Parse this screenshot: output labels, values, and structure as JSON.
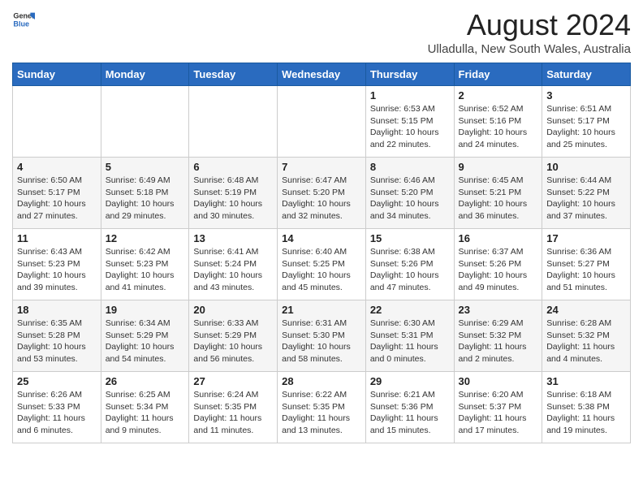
{
  "logo": {
    "line1": "General",
    "line2": "Blue"
  },
  "title": "August 2024",
  "location": "Ulladulla, New South Wales, Australia",
  "days_of_week": [
    "Sunday",
    "Monday",
    "Tuesday",
    "Wednesday",
    "Thursday",
    "Friday",
    "Saturday"
  ],
  "weeks": [
    [
      {
        "day": "",
        "info": ""
      },
      {
        "day": "",
        "info": ""
      },
      {
        "day": "",
        "info": ""
      },
      {
        "day": "",
        "info": ""
      },
      {
        "day": "1",
        "info": "Sunrise: 6:53 AM\nSunset: 5:15 PM\nDaylight: 10 hours\nand 22 minutes."
      },
      {
        "day": "2",
        "info": "Sunrise: 6:52 AM\nSunset: 5:16 PM\nDaylight: 10 hours\nand 24 minutes."
      },
      {
        "day": "3",
        "info": "Sunrise: 6:51 AM\nSunset: 5:17 PM\nDaylight: 10 hours\nand 25 minutes."
      }
    ],
    [
      {
        "day": "4",
        "info": "Sunrise: 6:50 AM\nSunset: 5:17 PM\nDaylight: 10 hours\nand 27 minutes."
      },
      {
        "day": "5",
        "info": "Sunrise: 6:49 AM\nSunset: 5:18 PM\nDaylight: 10 hours\nand 29 minutes."
      },
      {
        "day": "6",
        "info": "Sunrise: 6:48 AM\nSunset: 5:19 PM\nDaylight: 10 hours\nand 30 minutes."
      },
      {
        "day": "7",
        "info": "Sunrise: 6:47 AM\nSunset: 5:20 PM\nDaylight: 10 hours\nand 32 minutes."
      },
      {
        "day": "8",
        "info": "Sunrise: 6:46 AM\nSunset: 5:20 PM\nDaylight: 10 hours\nand 34 minutes."
      },
      {
        "day": "9",
        "info": "Sunrise: 6:45 AM\nSunset: 5:21 PM\nDaylight: 10 hours\nand 36 minutes."
      },
      {
        "day": "10",
        "info": "Sunrise: 6:44 AM\nSunset: 5:22 PM\nDaylight: 10 hours\nand 37 minutes."
      }
    ],
    [
      {
        "day": "11",
        "info": "Sunrise: 6:43 AM\nSunset: 5:23 PM\nDaylight: 10 hours\nand 39 minutes."
      },
      {
        "day": "12",
        "info": "Sunrise: 6:42 AM\nSunset: 5:23 PM\nDaylight: 10 hours\nand 41 minutes."
      },
      {
        "day": "13",
        "info": "Sunrise: 6:41 AM\nSunset: 5:24 PM\nDaylight: 10 hours\nand 43 minutes."
      },
      {
        "day": "14",
        "info": "Sunrise: 6:40 AM\nSunset: 5:25 PM\nDaylight: 10 hours\nand 45 minutes."
      },
      {
        "day": "15",
        "info": "Sunrise: 6:38 AM\nSunset: 5:26 PM\nDaylight: 10 hours\nand 47 minutes."
      },
      {
        "day": "16",
        "info": "Sunrise: 6:37 AM\nSunset: 5:26 PM\nDaylight: 10 hours\nand 49 minutes."
      },
      {
        "day": "17",
        "info": "Sunrise: 6:36 AM\nSunset: 5:27 PM\nDaylight: 10 hours\nand 51 minutes."
      }
    ],
    [
      {
        "day": "18",
        "info": "Sunrise: 6:35 AM\nSunset: 5:28 PM\nDaylight: 10 hours\nand 53 minutes."
      },
      {
        "day": "19",
        "info": "Sunrise: 6:34 AM\nSunset: 5:29 PM\nDaylight: 10 hours\nand 54 minutes."
      },
      {
        "day": "20",
        "info": "Sunrise: 6:33 AM\nSunset: 5:29 PM\nDaylight: 10 hours\nand 56 minutes."
      },
      {
        "day": "21",
        "info": "Sunrise: 6:31 AM\nSunset: 5:30 PM\nDaylight: 10 hours\nand 58 minutes."
      },
      {
        "day": "22",
        "info": "Sunrise: 6:30 AM\nSunset: 5:31 PM\nDaylight: 11 hours\nand 0 minutes."
      },
      {
        "day": "23",
        "info": "Sunrise: 6:29 AM\nSunset: 5:32 PM\nDaylight: 11 hours\nand 2 minutes."
      },
      {
        "day": "24",
        "info": "Sunrise: 6:28 AM\nSunset: 5:32 PM\nDaylight: 11 hours\nand 4 minutes."
      }
    ],
    [
      {
        "day": "25",
        "info": "Sunrise: 6:26 AM\nSunset: 5:33 PM\nDaylight: 11 hours\nand 6 minutes."
      },
      {
        "day": "26",
        "info": "Sunrise: 6:25 AM\nSunset: 5:34 PM\nDaylight: 11 hours\nand 9 minutes."
      },
      {
        "day": "27",
        "info": "Sunrise: 6:24 AM\nSunset: 5:35 PM\nDaylight: 11 hours\nand 11 minutes."
      },
      {
        "day": "28",
        "info": "Sunrise: 6:22 AM\nSunset: 5:35 PM\nDaylight: 11 hours\nand 13 minutes."
      },
      {
        "day": "29",
        "info": "Sunrise: 6:21 AM\nSunset: 5:36 PM\nDaylight: 11 hours\nand 15 minutes."
      },
      {
        "day": "30",
        "info": "Sunrise: 6:20 AM\nSunset: 5:37 PM\nDaylight: 11 hours\nand 17 minutes."
      },
      {
        "day": "31",
        "info": "Sunrise: 6:18 AM\nSunset: 5:38 PM\nDaylight: 11 hours\nand 19 minutes."
      }
    ]
  ]
}
